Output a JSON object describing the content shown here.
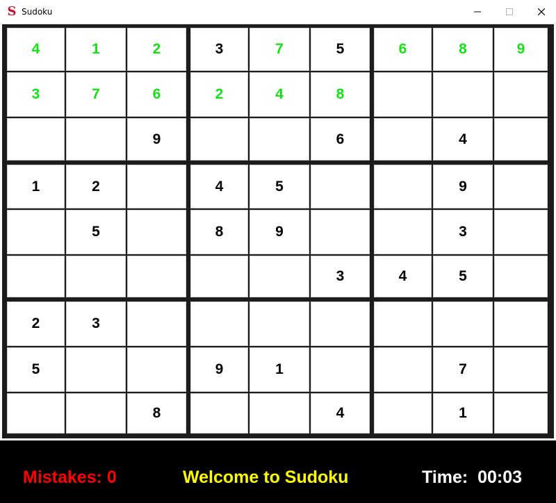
{
  "window": {
    "title": "Sudoku",
    "app_icon_letter": "S",
    "app_icon_color": "#c8102e",
    "controls": [
      "minimize",
      "maximize",
      "close"
    ]
  },
  "board": {
    "green_color": "#14e214",
    "black_color": "#000000",
    "rows": [
      [
        {
          "v": "4",
          "c": "g"
        },
        {
          "v": "1",
          "c": "g"
        },
        {
          "v": "2",
          "c": "g"
        },
        {
          "v": "3",
          "c": "b"
        },
        {
          "v": "7",
          "c": "g"
        },
        {
          "v": "5",
          "c": "b"
        },
        {
          "v": "6",
          "c": "g"
        },
        {
          "v": "8",
          "c": "g"
        },
        {
          "v": "9",
          "c": "g"
        }
      ],
      [
        {
          "v": "3",
          "c": "g"
        },
        {
          "v": "7",
          "c": "g"
        },
        {
          "v": "6",
          "c": "g"
        },
        {
          "v": "2",
          "c": "g"
        },
        {
          "v": "4",
          "c": "g"
        },
        {
          "v": "8",
          "c": "g"
        },
        {
          "v": "",
          "c": "b"
        },
        {
          "v": "",
          "c": "b"
        },
        {
          "v": "",
          "c": "b"
        }
      ],
      [
        {
          "v": "",
          "c": "b"
        },
        {
          "v": "",
          "c": "b"
        },
        {
          "v": "9",
          "c": "b"
        },
        {
          "v": "",
          "c": "b"
        },
        {
          "v": "",
          "c": "b"
        },
        {
          "v": "6",
          "c": "b"
        },
        {
          "v": "",
          "c": "b"
        },
        {
          "v": "4",
          "c": "b"
        },
        {
          "v": "",
          "c": "b"
        }
      ],
      [
        {
          "v": "1",
          "c": "b"
        },
        {
          "v": "2",
          "c": "b"
        },
        {
          "v": "",
          "c": "b"
        },
        {
          "v": "4",
          "c": "b"
        },
        {
          "v": "5",
          "c": "b"
        },
        {
          "v": "",
          "c": "b"
        },
        {
          "v": "",
          "c": "b"
        },
        {
          "v": "9",
          "c": "b"
        },
        {
          "v": "",
          "c": "b"
        }
      ],
      [
        {
          "v": "",
          "c": "b"
        },
        {
          "v": "5",
          "c": "b"
        },
        {
          "v": "",
          "c": "b"
        },
        {
          "v": "8",
          "c": "b"
        },
        {
          "v": "9",
          "c": "b"
        },
        {
          "v": "",
          "c": "b"
        },
        {
          "v": "",
          "c": "b"
        },
        {
          "v": "3",
          "c": "b"
        },
        {
          "v": "",
          "c": "b"
        }
      ],
      [
        {
          "v": "",
          "c": "b"
        },
        {
          "v": "",
          "c": "b"
        },
        {
          "v": "",
          "c": "b"
        },
        {
          "v": "",
          "c": "b"
        },
        {
          "v": "",
          "c": "b"
        },
        {
          "v": "3",
          "c": "b"
        },
        {
          "v": "4",
          "c": "b"
        },
        {
          "v": "5",
          "c": "b"
        },
        {
          "v": "",
          "c": "b"
        }
      ],
      [
        {
          "v": "2",
          "c": "b"
        },
        {
          "v": "3",
          "c": "b"
        },
        {
          "v": "",
          "c": "b"
        },
        {
          "v": "",
          "c": "b"
        },
        {
          "v": "",
          "c": "b"
        },
        {
          "v": "",
          "c": "b"
        },
        {
          "v": "",
          "c": "b"
        },
        {
          "v": "",
          "c": "b"
        },
        {
          "v": "",
          "c": "b"
        }
      ],
      [
        {
          "v": "5",
          "c": "b"
        },
        {
          "v": "",
          "c": "b"
        },
        {
          "v": "",
          "c": "b"
        },
        {
          "v": "9",
          "c": "b"
        },
        {
          "v": "1",
          "c": "b"
        },
        {
          "v": "",
          "c": "b"
        },
        {
          "v": "",
          "c": "b"
        },
        {
          "v": "7",
          "c": "b"
        },
        {
          "v": "",
          "c": "b"
        }
      ],
      [
        {
          "v": "",
          "c": "b"
        },
        {
          "v": "",
          "c": "b"
        },
        {
          "v": "8",
          "c": "b"
        },
        {
          "v": "",
          "c": "b"
        },
        {
          "v": "",
          "c": "b"
        },
        {
          "v": "4",
          "c": "b"
        },
        {
          "v": "",
          "c": "b"
        },
        {
          "v": "1",
          "c": "b"
        },
        {
          "v": "",
          "c": "b"
        }
      ]
    ]
  },
  "status": {
    "mistakes_text": "Mistakes: 0",
    "mistakes_color": "#ff0000",
    "welcome_text": "Welcome to Sudoku",
    "welcome_color": "#ffff00",
    "time_text": "Time:  00:03"
  }
}
